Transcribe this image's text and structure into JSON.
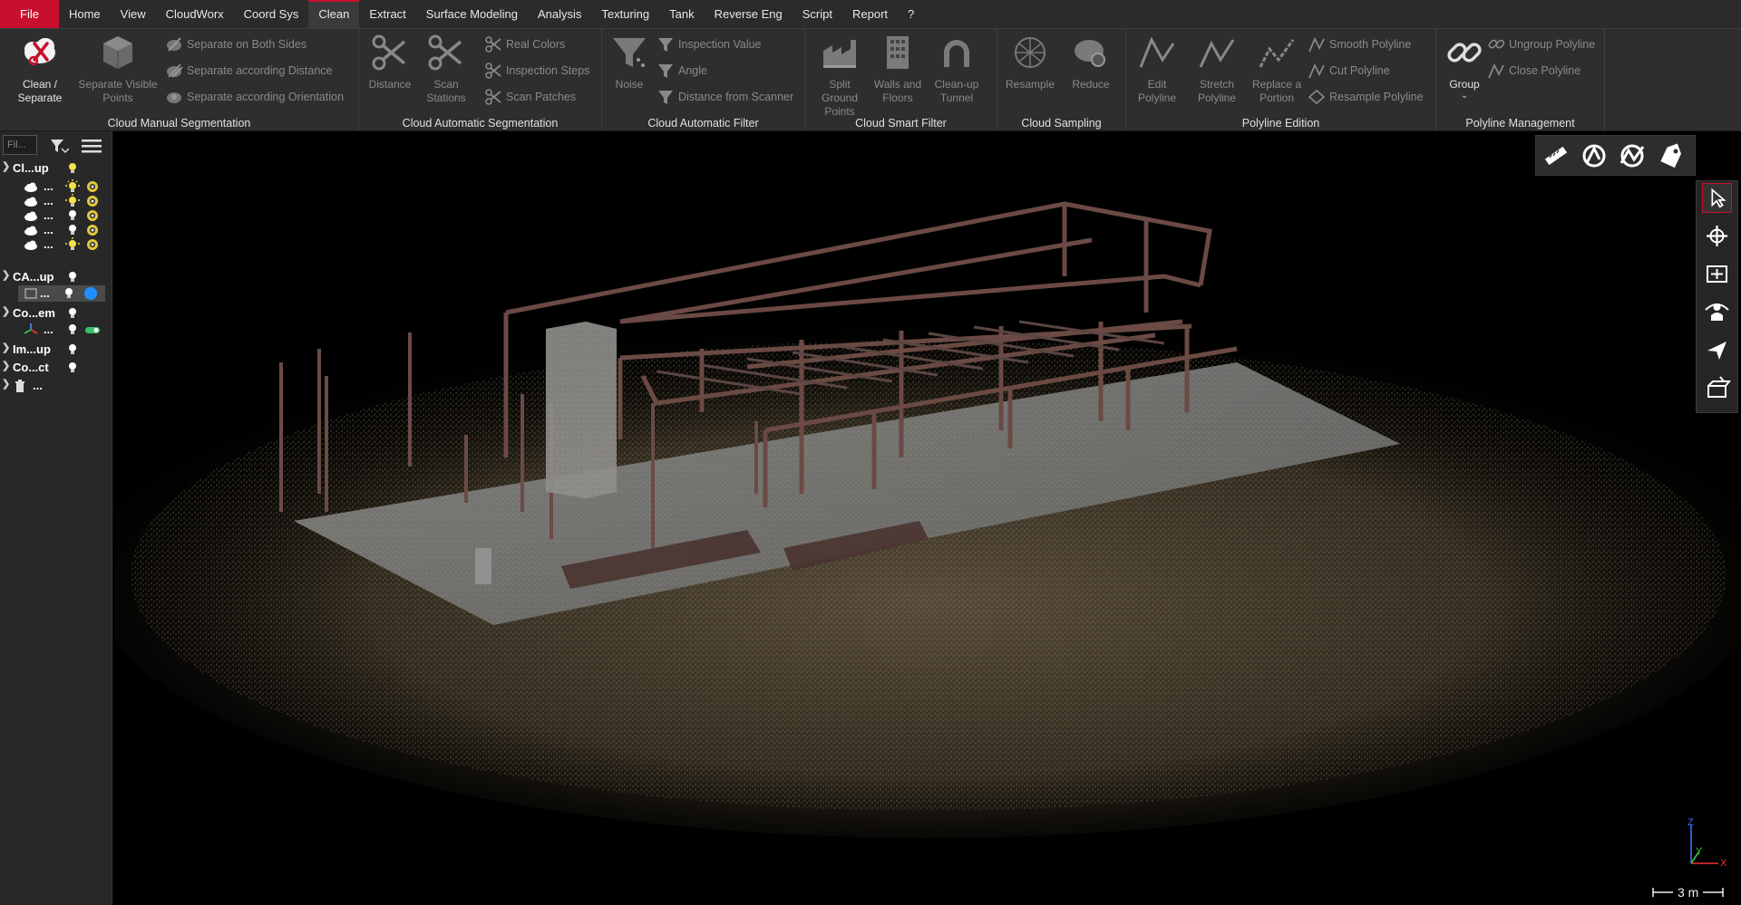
{
  "menu": {
    "items": [
      "File",
      "Home",
      "View",
      "CloudWorx",
      "Coord Sys",
      "Clean",
      "Extract",
      "Surface Modeling",
      "Analysis",
      "Texturing",
      "Tank",
      "Reverse Eng",
      "Script",
      "Report",
      "?"
    ],
    "active": "Clean"
  },
  "ribbon": {
    "manual_seg": {
      "label": "Cloud Manual Segmentation",
      "clean_separate": "Clean / Separate",
      "separate_visible": "Separate Visible Points",
      "both_sides": "Separate on Both Sides",
      "according_distance": "Separate according Distance",
      "according_orientation": "Separate according Orientation"
    },
    "auto_seg": {
      "label": "Cloud Automatic Segmentation",
      "distance": "Distance",
      "scan_stations": "Scan Stations",
      "real_colors": "Real Colors",
      "inspection_steps": "Inspection Steps",
      "scan_patches": "Scan Patches"
    },
    "auto_filter": {
      "label": "Cloud Automatic Filter",
      "noise": "Noise",
      "inspection_value": "Inspection Value",
      "angle": "Angle",
      "distance_from_scanner": "Distance from Scanner"
    },
    "smart_filter": {
      "label": "Cloud Smart Filter",
      "split_ground": "Split Ground Points",
      "walls_floors": "Walls and Floors",
      "cleanup_tunnel": "Clean-up Tunnel"
    },
    "sampling": {
      "label": "Cloud Sampling",
      "resample": "Resample",
      "reduce": "Reduce"
    },
    "polyline_edition": {
      "label": "Polyline Edition",
      "edit": "Edit Polyline",
      "stretch": "Stretch Polyline",
      "replace": "Replace a Portion",
      "smooth": "Smooth Polyline",
      "cut": "Cut Polyline",
      "resample": "Resample Polyline"
    },
    "polyline_mgmt": {
      "label": "Polyline Management",
      "group": "Group",
      "ungroup": "Ungroup Polyline",
      "close": "Close Polyline"
    }
  },
  "tree": {
    "filter_placeholder": "Fil...",
    "rows": [
      {
        "label": "Cl...up"
      },
      {
        "label": "..."
      },
      {
        "label": "..."
      },
      {
        "label": "..."
      },
      {
        "label": "..."
      },
      {
        "label": "..."
      },
      {
        "label": "CA...up"
      },
      {
        "label": "..."
      },
      {
        "label": "Co...em"
      },
      {
        "label": "..."
      },
      {
        "label": "Im...up"
      },
      {
        "label": "Co...ct"
      },
      {
        "label": "..."
      }
    ]
  },
  "viewport": {
    "axis": {
      "x": "X",
      "y": "Y",
      "z": "Z"
    },
    "scale": "3 m"
  },
  "colors": {
    "accent": "#c8102e",
    "bulb": "#f5e24a",
    "selected_dot": "#1e90ff"
  }
}
